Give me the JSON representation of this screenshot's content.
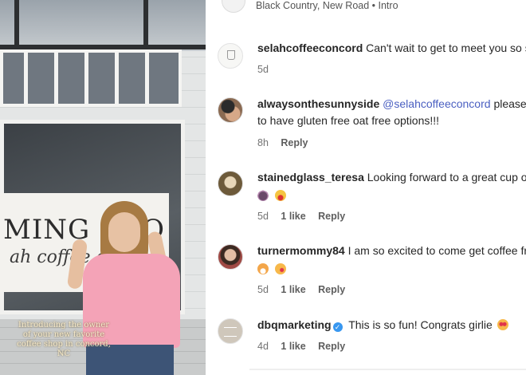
{
  "photo": {
    "sign_title": "MING SOO",
    "sign_subtitle": "ah coffee co",
    "caption": "Introducing the owner of your new favorite coffee shop in concord, NC"
  },
  "header": {
    "audio_meta": "Black Country, New Road • Intro"
  },
  "comments": [
    {
      "username": "selahcoffeeconcord",
      "text": "Can't wait to get to meet you so soon!",
      "time": "5d",
      "likes": "",
      "reply_label": ""
    },
    {
      "username": "alwaysonthesunnyside",
      "mention": "@selahcoffeeconcord",
      "text_line1": "please make sure",
      "text_line2": "to have gluten free oat free options!!!",
      "time": "8h",
      "likes": "",
      "reply_label": "Reply"
    },
    {
      "username": "stainedglass_teresa",
      "text": "Looking forward to a great cup of coffee",
      "time": "5d",
      "likes": "1 like",
      "reply_label": "Reply"
    },
    {
      "username": "turnermommy84",
      "text": "I am so excited to come get coffee from you",
      "time": "5d",
      "likes": "1 like",
      "reply_label": "Reply"
    },
    {
      "username": "dbqmarketing",
      "text": "This is so fun! Congrats girlie",
      "time": "4d",
      "likes": "1 like",
      "reply_label": "Reply"
    }
  ]
}
